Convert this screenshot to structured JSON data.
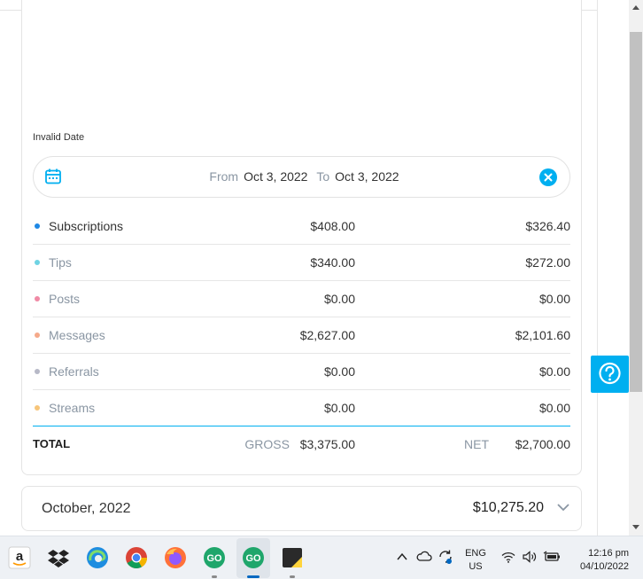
{
  "stats": {
    "invalid_date_label": "Invalid Date",
    "date_range": {
      "from_label": "From",
      "from_value": "Oct 3, 2022",
      "to_label": "To",
      "to_value": "Oct 3, 2022"
    },
    "rows": [
      {
        "name": "Subscriptions",
        "gross": "$408.00",
        "net": "$326.40",
        "color": "#1e88e5",
        "active": true
      },
      {
        "name": "Tips",
        "gross": "$340.00",
        "net": "$272.00",
        "color": "#6fd3e3",
        "active": false
      },
      {
        "name": "Posts",
        "gross": "$0.00",
        "net": "$0.00",
        "color": "#f08aa5",
        "active": false
      },
      {
        "name": "Messages",
        "gross": "$2,627.00",
        "net": "$2,101.60",
        "color": "#f5a98a",
        "active": false
      },
      {
        "name": "Referrals",
        "gross": "$0.00",
        "net": "$0.00",
        "color": "#b7b9c7",
        "active": false
      },
      {
        "name": "Streams",
        "gross": "$0.00",
        "net": "$0.00",
        "color": "#f7c57a",
        "active": false
      }
    ],
    "total": {
      "label": "TOTAL",
      "gross_label": "GROSS",
      "gross_value": "$3,375.00",
      "net_label": "NET",
      "net_value": "$2,700.00"
    }
  },
  "month": {
    "label": "October, 2022",
    "total": "$10,275.20"
  },
  "colors": {
    "accent": "#00aff0",
    "muted_text": "#8a96a3"
  },
  "help_button_icon": "help-question-icon",
  "taskbar": {
    "apps": [
      "amazon-icon",
      "dropbox-icon",
      "edge-icon",
      "chrome-icon",
      "firefox-icon",
      "app-go-icon",
      "app-go-active-icon",
      "sticky-notes-icon"
    ],
    "tray": {
      "lang_top": "ENG",
      "lang_bottom": "US",
      "time": "12:16 pm",
      "date": "04/10/2022"
    }
  }
}
